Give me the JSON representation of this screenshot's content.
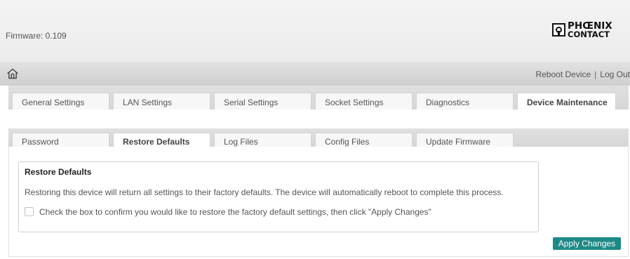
{
  "header": {
    "firmware": "Firmware: 0.109",
    "logo_line1": "PHŒNIX",
    "logo_line2": "CONTACT"
  },
  "nav": {
    "home_icon": "home-icon",
    "reboot": "Reboot Device",
    "separator": "|",
    "logout": "Log Out"
  },
  "main_tabs": [
    {
      "label": "General Settings"
    },
    {
      "label": "LAN Settings"
    },
    {
      "label": "Serial Settings"
    },
    {
      "label": "Socket Settings"
    },
    {
      "label": "Diagnostics"
    },
    {
      "label": "Device Maintenance",
      "active": true
    }
  ],
  "sub_tabs": [
    {
      "label": "Password"
    },
    {
      "label": "Restore Defaults",
      "active": true
    },
    {
      "label": "Log Files"
    },
    {
      "label": "Config Files"
    },
    {
      "label": "Update Firmware"
    }
  ],
  "panel": {
    "title": "Restore Defaults",
    "description": "Restoring this device will return all settings to their factory defaults. The device will automatically reboot to complete this process.",
    "confirm_label": "Check the box to confirm you would like to restore the factory default settings, then click \"Apply Changes\"",
    "confirm_checked": false
  },
  "actions": {
    "apply_label": "Apply Changes"
  },
  "colors": {
    "accent": "#1e8a86"
  }
}
